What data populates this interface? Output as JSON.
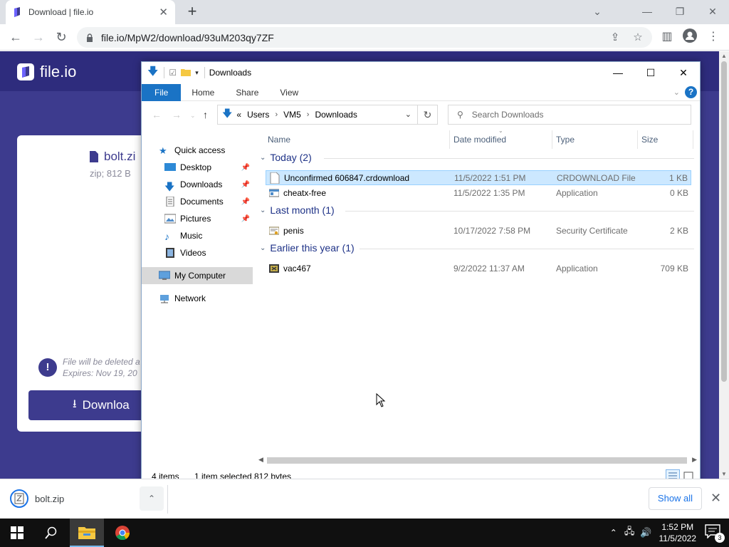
{
  "browser": {
    "tab_title": "Download | file.io",
    "url": "file.io/MpW2/download/93uM203qy7ZF"
  },
  "page": {
    "brand": "file.io",
    "file_name": "bolt.zi",
    "file_meta": "zip; 812 B",
    "warning_line1": "File will be deleted a",
    "warning_line2": "Expires: Nov 19, 20",
    "download_label": "Downloa"
  },
  "explorer": {
    "title": "Downloads",
    "ribbon_tabs": [
      "File",
      "Home",
      "Share",
      "View"
    ],
    "breadcrumb": [
      "Users",
      "VM5",
      "Downloads"
    ],
    "breadcrumb_prefix": "«",
    "search_placeholder": "Search Downloads",
    "nav": {
      "quick_access": "Quick access",
      "desktop": "Desktop",
      "downloads": "Downloads",
      "documents": "Documents",
      "pictures": "Pictures",
      "music": "Music",
      "videos": "Videos",
      "my_computer": "My Computer",
      "network": "Network"
    },
    "columns": {
      "name": "Name",
      "date": "Date modified",
      "type": "Type",
      "size": "Size"
    },
    "groups": [
      {
        "label": "Today (2)",
        "files": [
          {
            "name": "Unconfirmed 606847.crdownload",
            "date": "11/5/2022 1:51 PM",
            "type": "CRDOWNLOAD File",
            "size": "1 KB",
            "icon": "blank-file-icon",
            "selected": true
          },
          {
            "name": "cheatx-free",
            "date": "11/5/2022 1:35 PM",
            "type": "Application",
            "size": "0 KB",
            "icon": "application-icon",
            "selected": false
          }
        ]
      },
      {
        "label": "Last month (1)",
        "files": [
          {
            "name": "penis",
            "date": "10/17/2022 7:58 PM",
            "type": "Security Certificate",
            "size": "2 KB",
            "icon": "certificate-icon",
            "selected": false
          }
        ]
      },
      {
        "label": "Earlier this year (1)",
        "files": [
          {
            "name": "vac467",
            "date": "9/2/2022 11:37 AM",
            "type": "Application",
            "size": "709 KB",
            "icon": "exe-icon",
            "selected": false
          }
        ]
      }
    ],
    "status": {
      "items": "4 items",
      "selected": "1 item selected",
      "size": "812 bytes"
    }
  },
  "shelf": {
    "filename": "bolt.zip",
    "show_all": "Show all"
  },
  "taskbar": {
    "time": "1:52 PM",
    "date": "11/5/2022",
    "notif_count": "3"
  },
  "colors": {
    "fileio_purple": "#3d3b8e",
    "explorer_blue": "#1a73c5",
    "selection": "#cce8ff"
  }
}
